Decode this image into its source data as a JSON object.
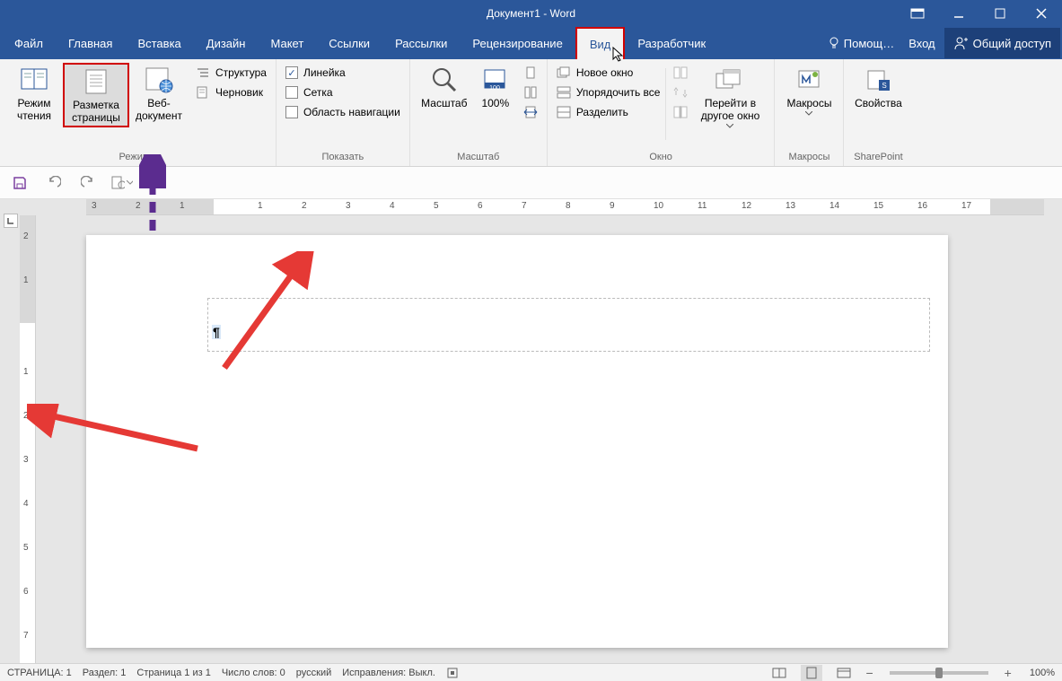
{
  "title": "Документ1 - Word",
  "tabs": {
    "file": "Файл",
    "home": "Главная",
    "insert": "Вставка",
    "design": "Дизайн",
    "layout": "Макет",
    "references": "Ссылки",
    "mailings": "Рассылки",
    "review": "Рецензирование",
    "view": "Вид",
    "developer": "Разработчик"
  },
  "help_placeholder": "Помощ…",
  "login": "Вход",
  "share": "Общий доступ",
  "ribbon": {
    "modes": {
      "label": "Режимы",
      "read": "Режим чтения",
      "print_layout": "Разметка страницы",
      "web": "Веб-документ",
      "outline": "Структура",
      "draft": "Черновик"
    },
    "show": {
      "label": "Показать",
      "ruler": "Линейка",
      "gridlines": "Сетка",
      "nav": "Область навигации"
    },
    "zoom": {
      "label": "Масштаб",
      "zoom": "Масштаб",
      "hundred": "100%"
    },
    "window": {
      "label": "Окно",
      "new": "Новое окно",
      "arrange": "Упорядочить все",
      "split": "Разделить",
      "switch": "Перейти в другое окно"
    },
    "macros": {
      "label": "Макросы",
      "btn": "Макросы"
    },
    "sharepoint": {
      "label": "SharePoint",
      "btn": "Свойства"
    }
  },
  "ruler_h": [
    "3",
    "2",
    "1",
    "1",
    "2",
    "3",
    "4",
    "5",
    "6",
    "7",
    "8",
    "9",
    "10",
    "11",
    "12",
    "13",
    "14",
    "15",
    "16",
    "17"
  ],
  "ruler_v": [
    "2",
    "1",
    "1",
    "2",
    "3",
    "4",
    "5",
    "6",
    "7"
  ],
  "status": {
    "page": "СТРАНИЦА: 1",
    "section": "Раздел: 1",
    "page_of": "Страница 1 из 1",
    "words": "Число слов: 0",
    "lang": "русский",
    "track": "Исправления: Выкл.",
    "zoom": "100%"
  },
  "pilcrow": "¶"
}
